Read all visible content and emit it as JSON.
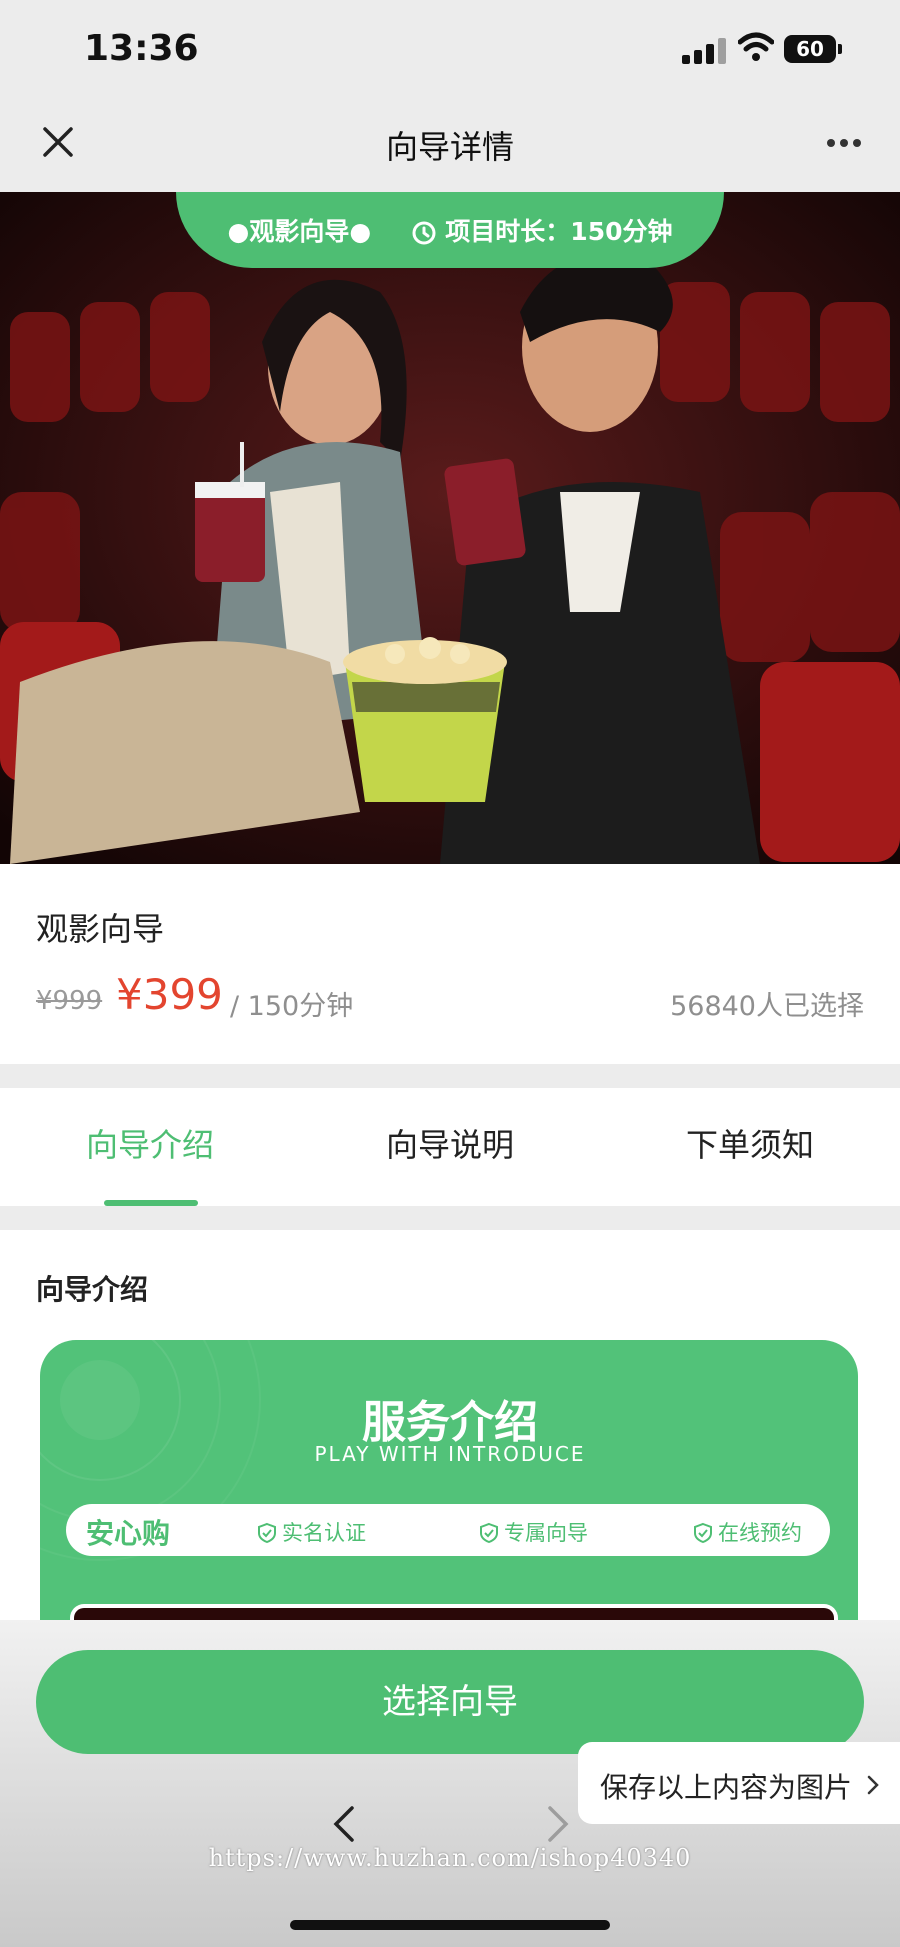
{
  "status_bar": {
    "time": "13:36",
    "battery": "60"
  },
  "nav": {
    "title": "向导详情",
    "close_icon": "close-icon",
    "more_icon": "more-icon"
  },
  "hero": {
    "tag_left": "●观影向导●",
    "tag_right": "项目时长：150分钟",
    "clock_icon": "clock-icon"
  },
  "product": {
    "title": "观影向导",
    "old_price": "¥999",
    "price": "¥399",
    "duration": "/ 150分钟",
    "selected": "56840人已选择"
  },
  "tabs": [
    {
      "label": "向导介绍",
      "active": true
    },
    {
      "label": "向导说明",
      "active": false
    },
    {
      "label": "下单须知",
      "active": false
    }
  ],
  "intro": {
    "section_title": "向导介绍",
    "card_title": "服务介绍",
    "card_subtitle": "PLAY WITH INTRODUCE",
    "badge_main": "安心购",
    "badges": [
      "实名认证",
      "专属向导",
      "在线预约"
    ]
  },
  "cta": {
    "label": "选择向导"
  },
  "save_tip": {
    "label": "保存以上内容为图片"
  },
  "watermark": "https://www.huzhan.com/ishop40340",
  "colors": {
    "accent": "#4ebe73",
    "price": "#e3452f"
  }
}
